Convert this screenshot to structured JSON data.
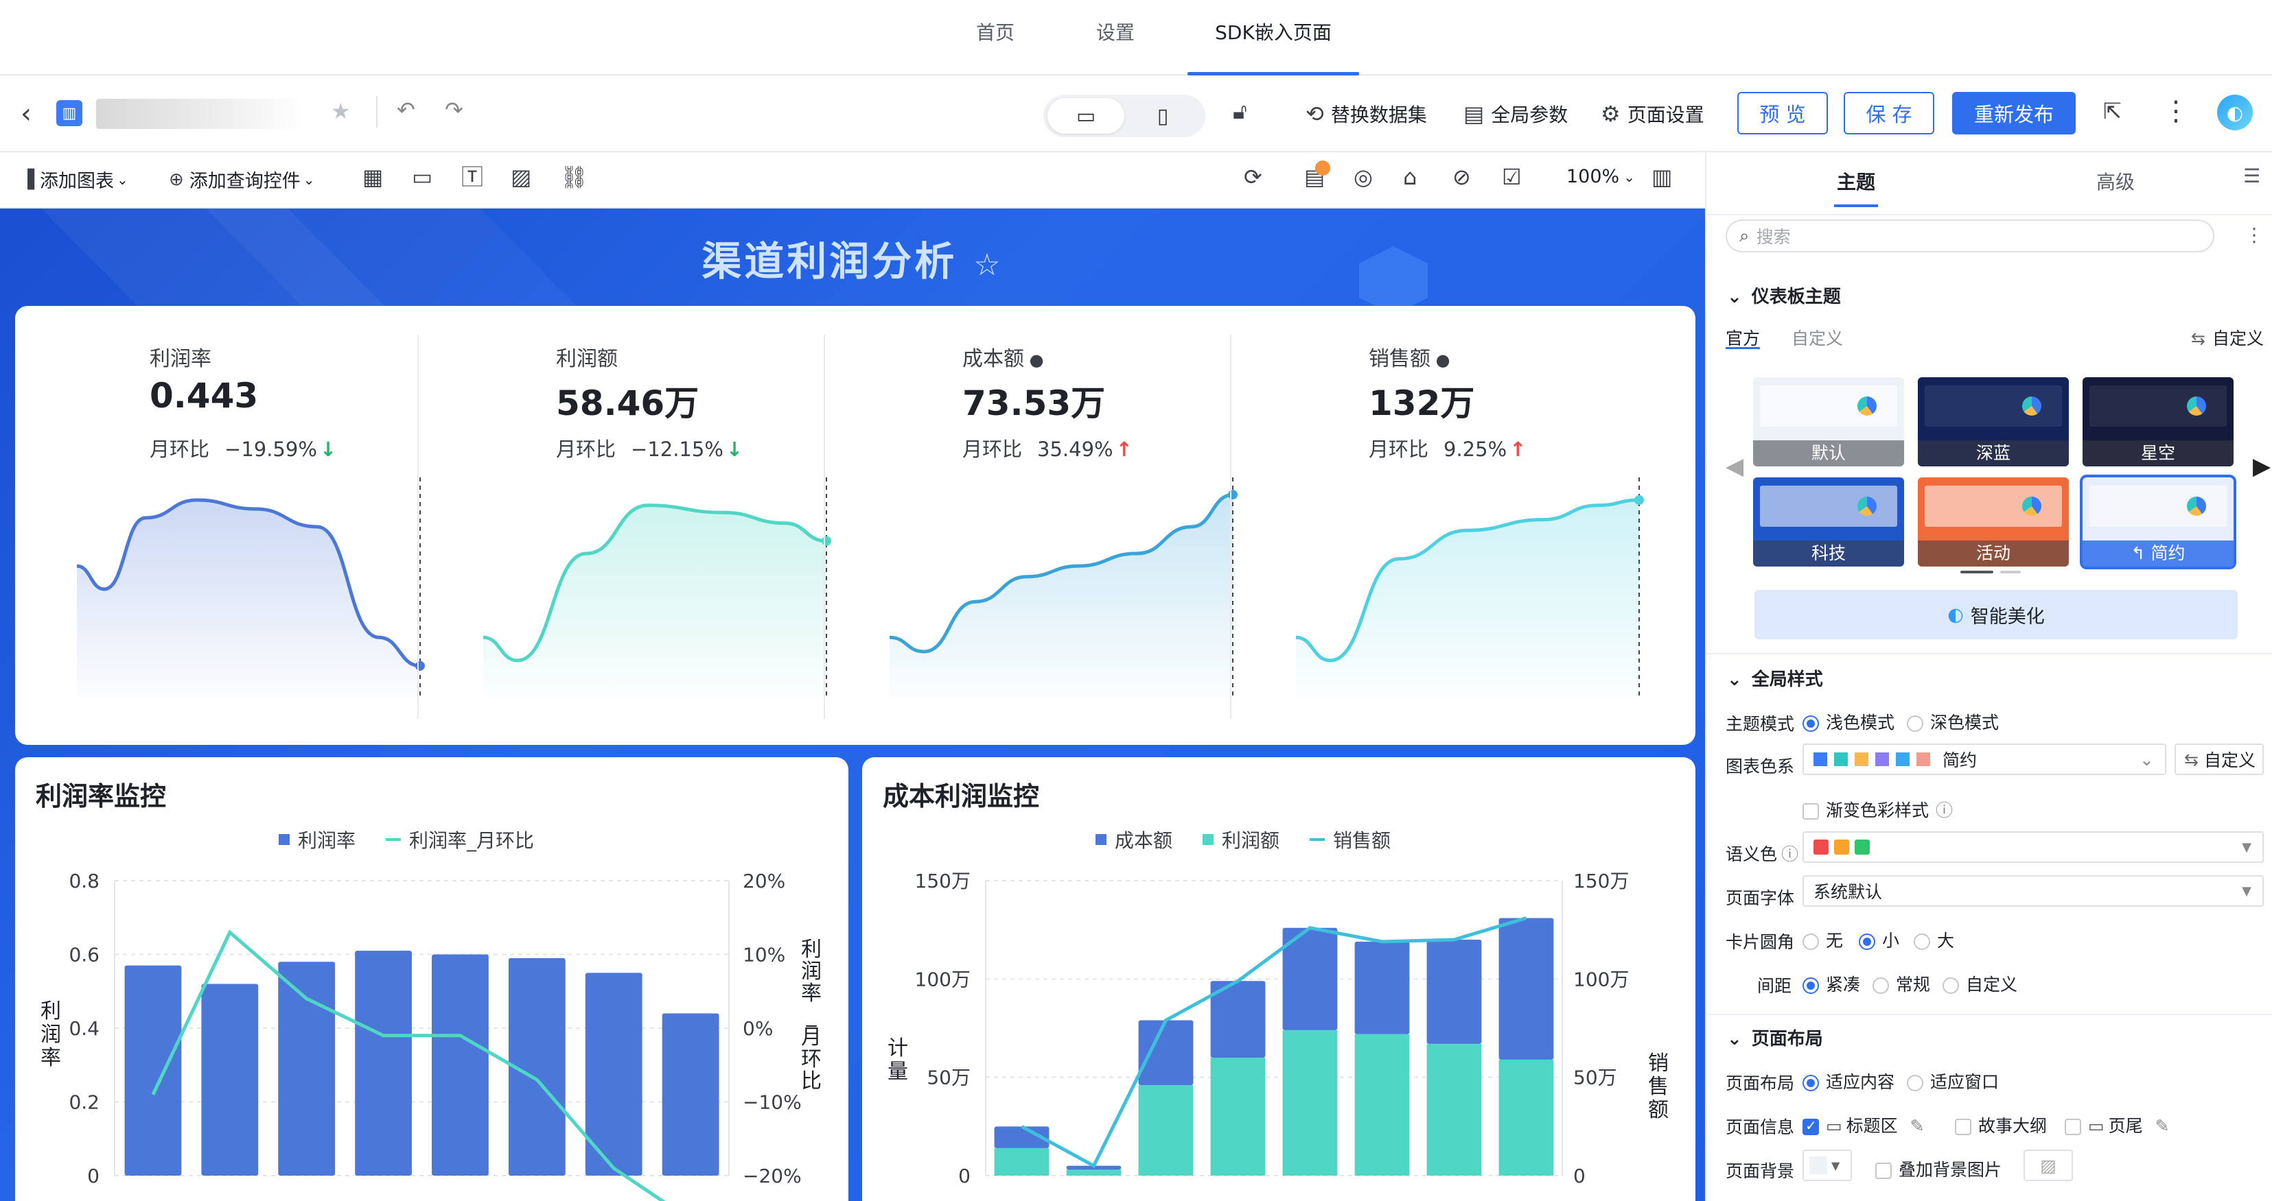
{
  "top_nav": {
    "items": [
      "首页",
      "设置",
      "SDK嵌入页面"
    ],
    "active": 2
  },
  "toolbar": {
    "device_desktop": "desktop-icon",
    "device_mobile": "mobile-icon",
    "replace_dataset": "替换数据集",
    "global_params": "全局参数",
    "page_settings": "页面设置",
    "preview": "预 览",
    "save": "保 存",
    "republish": "重新发布"
  },
  "subbar": {
    "add_chart": "添加图表",
    "add_query": "添加查询控件",
    "zoom": "100%"
  },
  "dashboard": {
    "title": "渠道利润分析",
    "kpis": [
      {
        "label": "利润率",
        "value": "0.443",
        "cmp_label": "月环比",
        "cmp_value": "−19.59%",
        "dir": "down",
        "color": "#4a77d8",
        "info": false
      },
      {
        "label": "利润额",
        "value": "58.46万",
        "cmp_label": "月环比",
        "cmp_value": "−12.15%",
        "dir": "down",
        "color": "#4fd6c4",
        "info": false
      },
      {
        "label": "成本额",
        "value": "73.53万",
        "cmp_label": "月环比",
        "cmp_value": "35.49%",
        "dir": "up",
        "color": "#3ba3d8",
        "info": true
      },
      {
        "label": "销售额",
        "value": "132万",
        "cmp_label": "月环比",
        "cmp_value": "9.25%",
        "dir": "up",
        "color": "#4fd0e0",
        "info": true
      }
    ],
    "profit_card": {
      "title": "利润率监控",
      "legend_bar": "利润率",
      "legend_line": "利润率_月环比",
      "ylabel_left": "利润率",
      "ylabel_right": "利润率_月环比",
      "left_ticks": [
        "0.8",
        "0.6",
        "0.4",
        "0.2",
        "0"
      ],
      "right_ticks": [
        "20%",
        "10%",
        "0%",
        "−10%",
        "−20%"
      ]
    },
    "cost_card": {
      "title": "成本利润监控",
      "legend_a": "成本额",
      "legend_b": "利润额",
      "legend_c": "销售额",
      "ylabel_left": "计量",
      "ylabel_right": "销售额",
      "left_ticks": [
        "150万",
        "100万",
        "50万",
        "0"
      ],
      "right_ticks": [
        "150万",
        "100万",
        "50万",
        "0"
      ]
    }
  },
  "chart_data": [
    {
      "type": "bar",
      "title": "利润率监控",
      "ylabel": "利润率",
      "ylim": [
        0,
        0.8
      ],
      "series": [
        {
          "name": "利润率",
          "values": [
            0.57,
            0.52,
            0.58,
            0.61,
            0.6,
            0.59,
            0.55,
            0.44
          ]
        },
        {
          "name": "利润率_月环比",
          "axis": "right",
          "ylim": [
            -0.2,
            0.2
          ],
          "values": [
            -0.09,
            0.13,
            0.04,
            -0.01,
            -0.01,
            -0.07,
            -0.19,
            -0.26
          ]
        }
      ]
    },
    {
      "type": "bar",
      "title": "成本利润监控",
      "ylabel": "计量",
      "ylim": [
        0,
        1500000
      ],
      "stacked": true,
      "series": [
        {
          "name": "利润额",
          "values": [
            140000,
            30000,
            460000,
            600000,
            740000,
            720000,
            670000,
            590000
          ]
        },
        {
          "name": "成本额",
          "values": [
            110000,
            20000,
            330000,
            390000,
            520000,
            470000,
            530000,
            720000
          ]
        },
        {
          "name": "销售额",
          "type": "line",
          "values": [
            250000,
            50000,
            790000,
            990000,
            1260000,
            1190000,
            1200000,
            1310000
          ]
        }
      ]
    }
  ],
  "panel": {
    "tabs": [
      "主题",
      "高级"
    ],
    "search_placeholder": "搜索",
    "section_theme": "仪表板主题",
    "theme_tabs": [
      "官方",
      "自定义"
    ],
    "custom": "自定义",
    "themes": [
      {
        "name": "默认",
        "bg": "#eef2f8"
      },
      {
        "name": "深蓝",
        "bg": "#13235a"
      },
      {
        "name": "星空",
        "bg": "#141a3a"
      },
      {
        "name": "科技",
        "bg": "#1f56c8"
      },
      {
        "name": "活动",
        "bg": "#f06a3a"
      },
      {
        "name": "简约",
        "bg": "#e9eefb"
      }
    ],
    "smart_beautify": "智能美化",
    "section_global": "全局样式",
    "theme_mode_label": "主题模式",
    "light_mode": "浅色模式",
    "dark_mode": "深色模式",
    "palette_label": "图表色系",
    "palette_value": "简约",
    "palette_colors": [
      "#3b7cf6",
      "#2ec5c2",
      "#f7b94a",
      "#8d7cf0",
      "#3aa8f0",
      "#f59a8f"
    ],
    "gradient_label": "渐变色彩样式",
    "semantic_label": "语义色",
    "semantic_colors": [
      "#f04a4a",
      "#f7a32a",
      "#2fc46a"
    ],
    "font_label": "页面字体",
    "font_value": "系统默认",
    "radius_label": "卡片圆角",
    "radius_options": [
      "无",
      "小",
      "大"
    ],
    "spacing_label": "间距",
    "spacing_options": [
      "紧凑",
      "常规",
      "自定义"
    ],
    "section_layout": "页面布局",
    "layout_label": "页面布局",
    "layout_options": [
      "适应内容",
      "适应窗口"
    ],
    "info_label": "页面信息",
    "info_options": [
      "标题区",
      "故事大纲",
      "页尾"
    ],
    "bg_label": "页面背景",
    "bg_overlay": "叠加背景图片"
  }
}
